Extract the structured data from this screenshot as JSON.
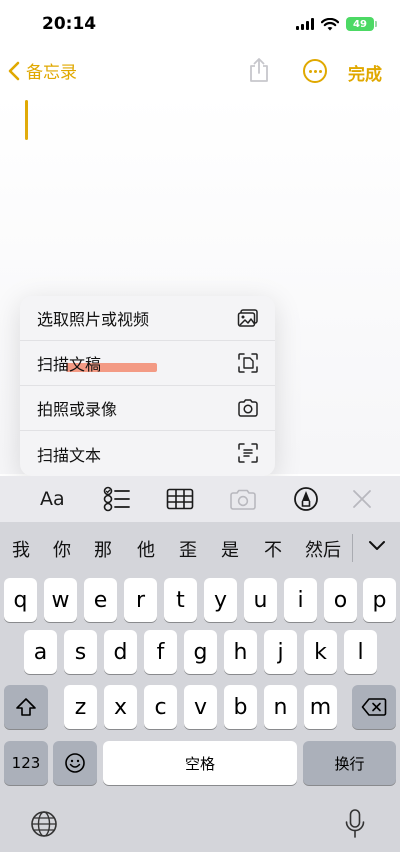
{
  "status": {
    "time": "20:14",
    "battery": "49"
  },
  "nav": {
    "back_label": "备忘录",
    "done_label": "完成"
  },
  "accent_color": "#e0a800",
  "popup_menu": {
    "items": [
      {
        "label": "选取照片或视频",
        "icon": "photo-library-icon"
      },
      {
        "label": "扫描文稿",
        "icon": "document-scan-icon"
      },
      {
        "label": "拍照或录像",
        "icon": "camera-icon"
      },
      {
        "label": "扫描文本",
        "icon": "text-scan-icon"
      }
    ]
  },
  "toolbar": {
    "format_label": "Aa",
    "icons": [
      "text-format-icon",
      "checklist-icon",
      "table-icon",
      "camera-icon",
      "markup-pen-icon",
      "close-icon"
    ]
  },
  "candidates": {
    "words": [
      "我",
      "你",
      "那",
      "他",
      "歪",
      "是",
      "不",
      "然后"
    ]
  },
  "keyboard": {
    "row1": [
      "q",
      "w",
      "e",
      "r",
      "t",
      "y",
      "u",
      "i",
      "o",
      "p"
    ],
    "row2": [
      "a",
      "s",
      "d",
      "f",
      "g",
      "h",
      "j",
      "k",
      "l"
    ],
    "row3": [
      "z",
      "x",
      "c",
      "v",
      "b",
      "n",
      "m"
    ],
    "numbers_key": "123",
    "space_key": "空格",
    "return_key": "换行"
  }
}
